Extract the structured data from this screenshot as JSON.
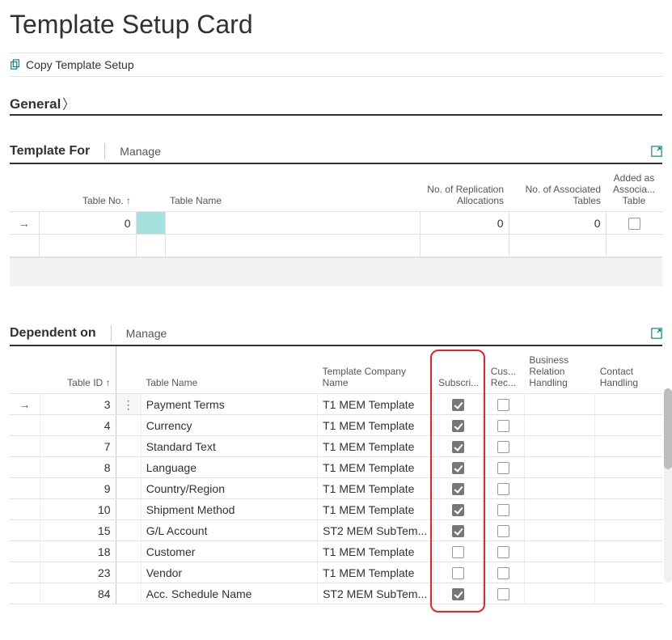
{
  "title": "Template Setup Card",
  "actions": {
    "copy_template_setup": "Copy Template Setup"
  },
  "general": {
    "label": "General"
  },
  "template_for": {
    "title": "Template For",
    "manage": "Manage",
    "columns": {
      "table_no": "Table No. ↑",
      "table_name": "Table Name",
      "replication_allocations": "No. of Replication Allocations",
      "associated_tables": "No. of Associated Tables",
      "added_as_associated": "Added as Associa... Table"
    },
    "row": {
      "table_no": "0",
      "table_name": "",
      "replication_allocations": "0",
      "associated_tables": "0",
      "added_as_associated": false
    }
  },
  "dependent_on": {
    "title": "Dependent on",
    "manage": "Manage",
    "columns": {
      "table_id": "Table ID ↑",
      "table_name": "Table Name",
      "template_company_name": "Template Company Name",
      "subscribe": "Subscri...",
      "cus_rec": "Cus... Rec...",
      "business_relation_handling": "Business Relation Handling",
      "contact_handling": "Contact Handling"
    },
    "rows": [
      {
        "table_id": "3",
        "table_name": "Payment Terms",
        "template_company_name": "T1 MEM Template",
        "subscribe": true,
        "cus_rec": false
      },
      {
        "table_id": "4",
        "table_name": "Currency",
        "template_company_name": "T1 MEM Template",
        "subscribe": true,
        "cus_rec": false
      },
      {
        "table_id": "7",
        "table_name": "Standard Text",
        "template_company_name": "T1 MEM Template",
        "subscribe": true,
        "cus_rec": false
      },
      {
        "table_id": "8",
        "table_name": "Language",
        "template_company_name": "T1 MEM Template",
        "subscribe": true,
        "cus_rec": false
      },
      {
        "table_id": "9",
        "table_name": "Country/Region",
        "template_company_name": "T1 MEM Template",
        "subscribe": true,
        "cus_rec": false
      },
      {
        "table_id": "10",
        "table_name": "Shipment Method",
        "template_company_name": "T1 MEM Template",
        "subscribe": true,
        "cus_rec": false
      },
      {
        "table_id": "15",
        "table_name": "G/L Account",
        "template_company_name": "ST2 MEM SubTem...",
        "subscribe": true,
        "cus_rec": false
      },
      {
        "table_id": "18",
        "table_name": "Customer",
        "template_company_name": "T1 MEM Template",
        "subscribe": false,
        "cus_rec": false
      },
      {
        "table_id": "23",
        "table_name": "Vendor",
        "template_company_name": "T1 MEM Template",
        "subscribe": false,
        "cus_rec": false
      },
      {
        "table_id": "84",
        "table_name": "Acc. Schedule Name",
        "template_company_name": "ST2 MEM SubTem...",
        "subscribe": true,
        "cus_rec": false
      }
    ]
  }
}
